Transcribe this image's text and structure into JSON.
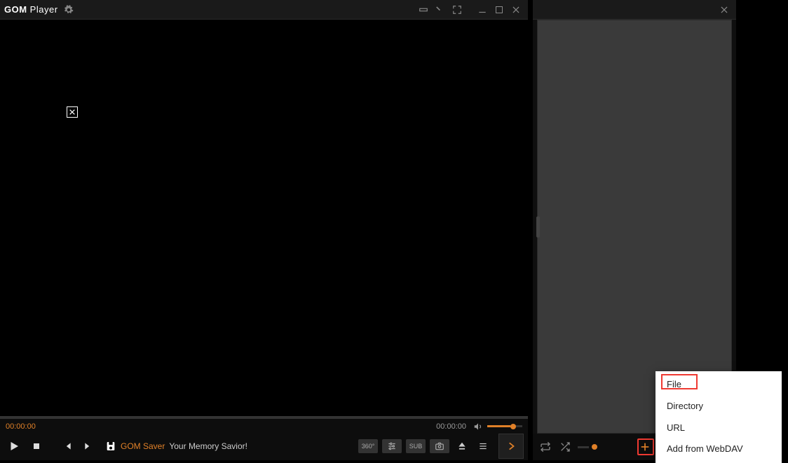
{
  "titlebar": {
    "app_name_bold": "GOM",
    "app_name_rest": " Player"
  },
  "playback": {
    "current_time": "00:00:00",
    "total_time": "00:00:00"
  },
  "ad": {
    "brand": "GOM Saver",
    "tagline": "Your Memory Savior!"
  },
  "mini_buttons": {
    "b360": "360°",
    "sub": "SUB"
  },
  "context_menu": {
    "items": [
      "File",
      "Directory",
      "URL",
      "Add from WebDAV"
    ]
  }
}
